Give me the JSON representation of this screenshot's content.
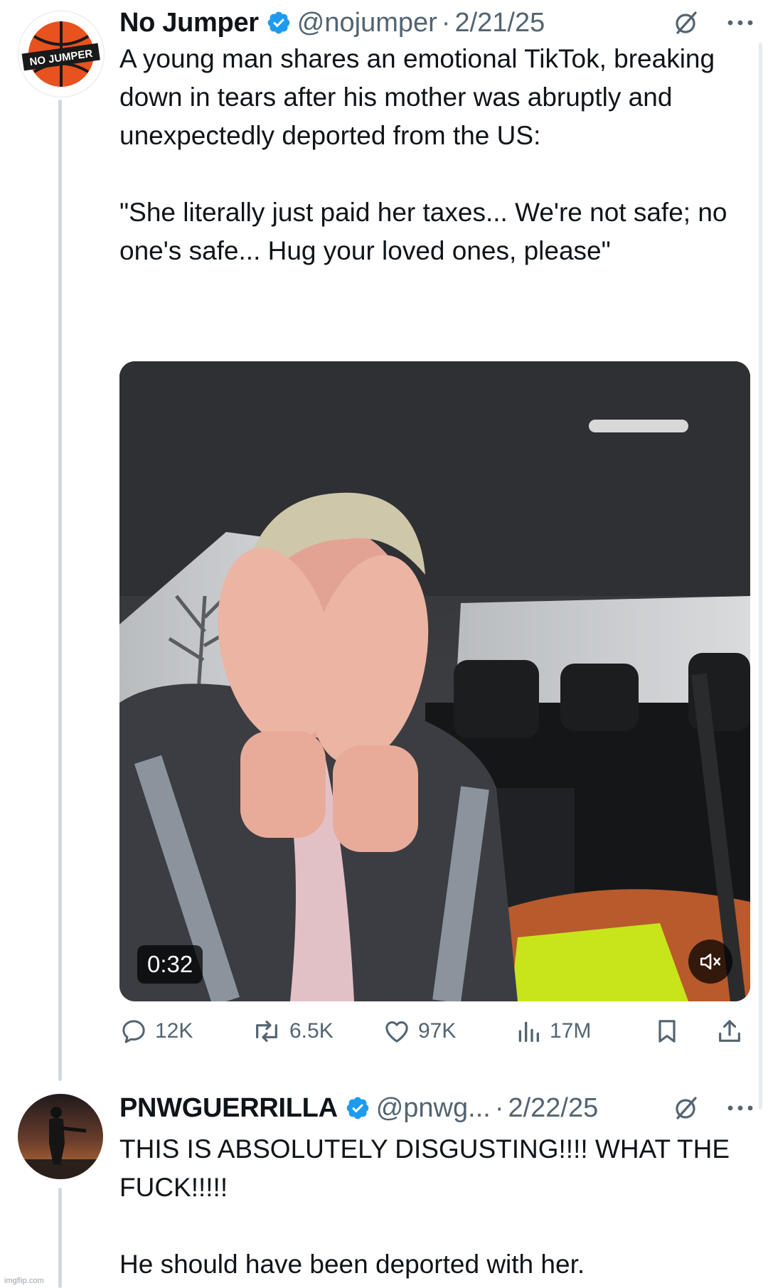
{
  "tweet1": {
    "name": "No Jumper",
    "handle": "@nojumper",
    "sep": "·",
    "date": "2/21/25",
    "avatar_text": "NO JUMPER",
    "text": "A young man shares an emotional TikTok, breaking down in tears after his mother was abruptly and unexpectedly deported from the US:\n\n\"She literally just paid her taxes... We're not safe; no one's safe... Hug your loved ones, please\"",
    "video_duration": "0:32",
    "actions": {
      "replies": "12K",
      "reposts": "6.5K",
      "likes": "97K",
      "views": "17M"
    }
  },
  "tweet2": {
    "name": "PNWGUERRILLA",
    "handle": "@pnwg...",
    "sep": "·",
    "date": "2/22/25",
    "text": "THIS IS ABSOLUTELY DISGUSTING!!!! WHAT THE FUCK!!!!!\n\nHe should have been deported with her."
  },
  "watermark": "imgflip.com",
  "colors": {
    "verified": "#1d9bf0",
    "secondary_text": "#536471",
    "primary_text": "#0f1419",
    "thread_line": "#cfd9de"
  },
  "icons": [
    "verified-badge-icon",
    "grok-icon",
    "more-icon",
    "reply-icon",
    "repost-icon",
    "like-icon",
    "views-icon",
    "bookmark-icon",
    "share-icon",
    "muted-speaker-icon"
  ]
}
